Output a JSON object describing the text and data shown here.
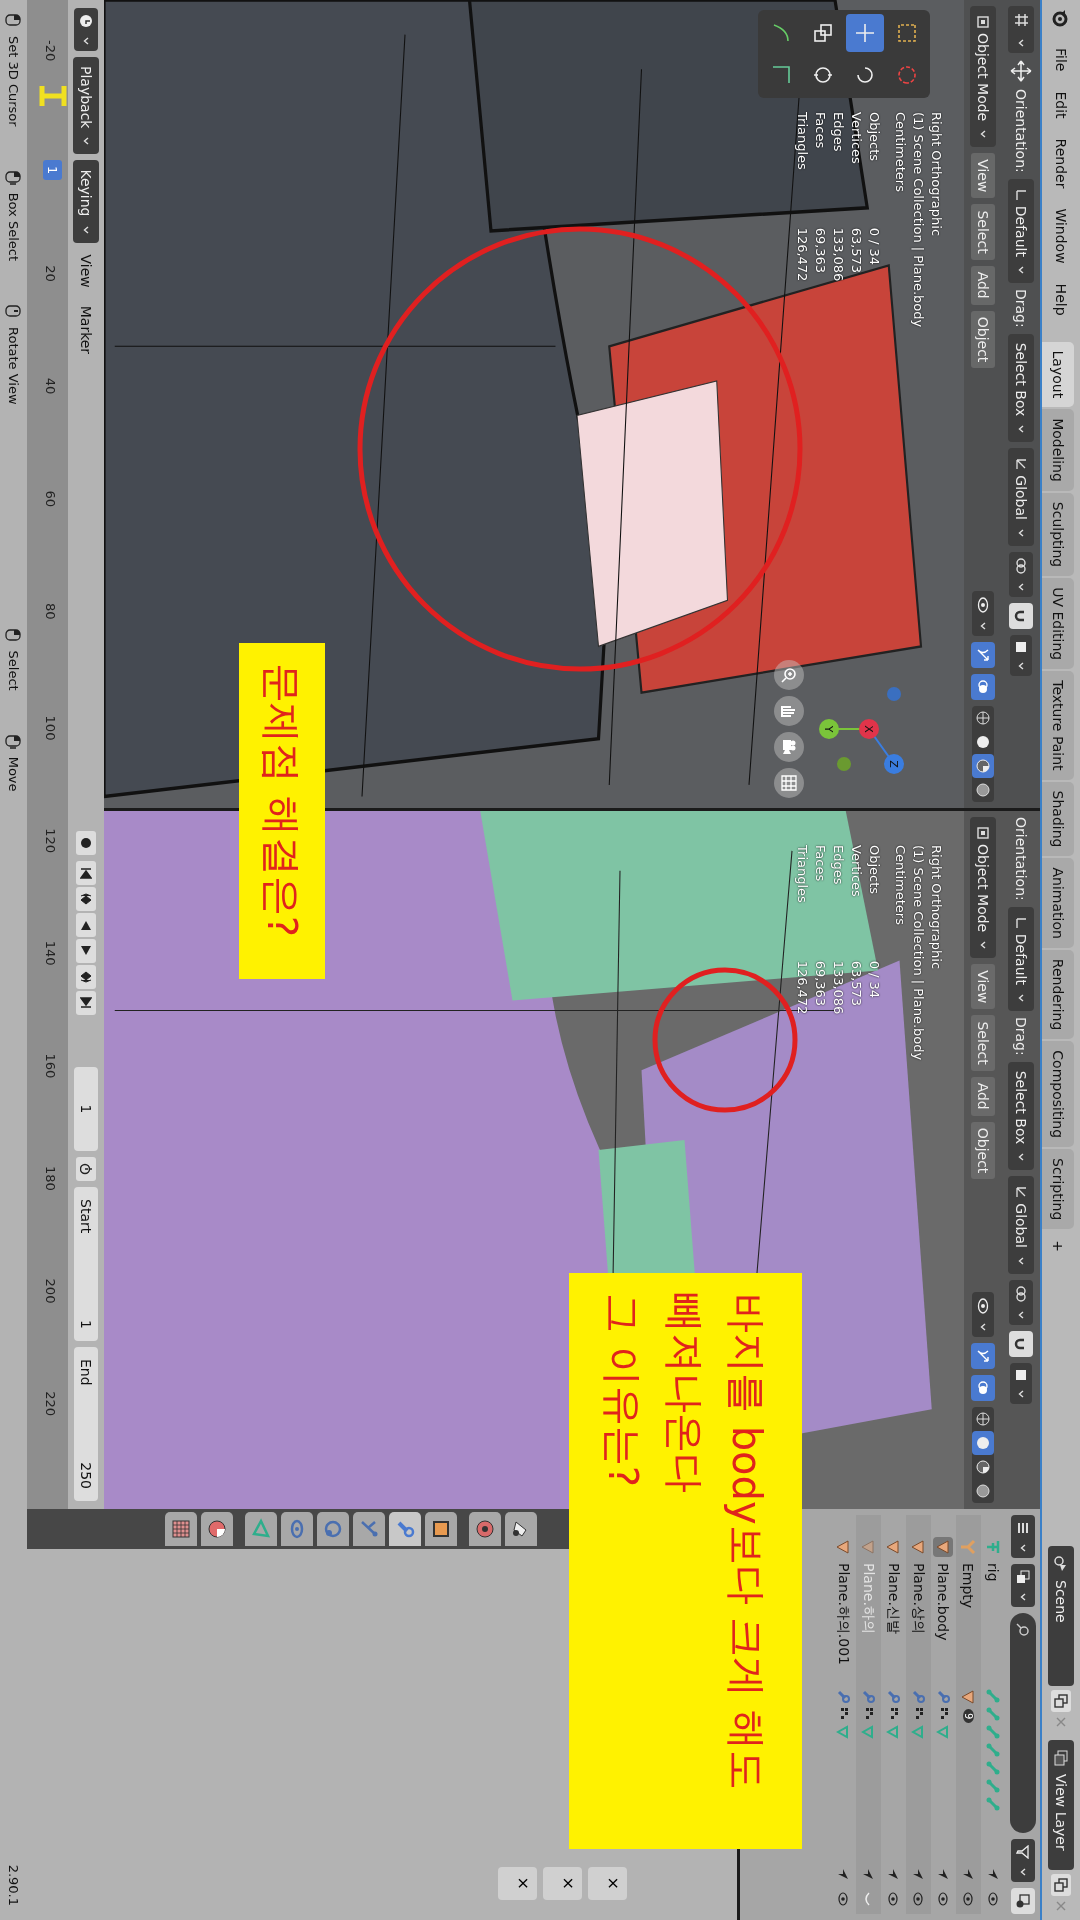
{
  "menu_bar": {
    "menus": [
      "File",
      "Edit",
      "Render",
      "Window",
      "Help"
    ],
    "workspace_tabs": [
      {
        "label": "Layout",
        "selected": true
      },
      {
        "label": "Modeling",
        "selected": false
      },
      {
        "label": "Sculpting",
        "selected": false
      },
      {
        "label": "UV Editing",
        "selected": false
      },
      {
        "label": "Texture Paint",
        "selected": false
      },
      {
        "label": "Shading",
        "selected": false
      },
      {
        "label": "Animation",
        "selected": false
      },
      {
        "label": "Rendering",
        "selected": false
      },
      {
        "label": "Compositing",
        "selected": false
      },
      {
        "label": "Scripting",
        "selected": false
      }
    ],
    "add_tab": "+",
    "scene": "Scene",
    "view_layer": "View Layer"
  },
  "viewports": [
    {
      "active_tool_button": true,
      "orientation_label": "Orientation:",
      "orientation": "Default",
      "drag_label": "Drag:",
      "drag": "Select Box",
      "transform_orientation": "Global",
      "mode": "Object Mode",
      "menus": [
        "View",
        "Select",
        "Add",
        "Object"
      ],
      "shading": [
        {
          "kind": "wireframe",
          "selected": false
        },
        {
          "kind": "solid",
          "selected": false
        },
        {
          "kind": "material",
          "selected": true
        },
        {
          "kind": "rendered",
          "selected": false
        }
      ],
      "tools": [
        {
          "kind": "select",
          "selected": false
        },
        {
          "kind": "cursor",
          "selected": false
        },
        {
          "kind": "move",
          "selected": true
        },
        {
          "kind": "rotate",
          "selected": false
        },
        {
          "kind": "scale",
          "selected": false
        },
        {
          "kind": "transform",
          "selected": false
        },
        {
          "kind": "annotate",
          "selected": false
        },
        {
          "kind": "measure",
          "selected": false
        }
      ],
      "overlay": [
        "Right Orthographic",
        "(1) Scene Collection | Plane.body",
        "Centimeters"
      ],
      "stats": [
        {
          "label": "Objects",
          "value": "0 / 34"
        },
        {
          "label": "Vertices",
          "value": "63,573"
        },
        {
          "label": "Edges",
          "value": "133,086"
        },
        {
          "label": "Faces",
          "value": "69,363"
        },
        {
          "label": "Triangles",
          "value": "126,472"
        }
      ],
      "axes": [
        "X",
        "Y",
        "Z"
      ]
    },
    {
      "active_tool_button": false,
      "orientation_label": "Orientation:",
      "orientation": "Default",
      "drag_label": "Drag:",
      "drag": "Select Box",
      "transform_orientation": "Global",
      "mode": "Object Mode",
      "menus": [
        "View",
        "Select",
        "Add",
        "Object"
      ],
      "shading": [
        {
          "kind": "wireframe",
          "selected": false
        },
        {
          "kind": "solid",
          "selected": true
        },
        {
          "kind": "material",
          "selected": false
        },
        {
          "kind": "rendered",
          "selected": false
        }
      ],
      "overlay": [
        "Right Orthographic",
        "(1) Scene Collection | Plane.body",
        "Centimeters"
      ],
      "stats": [
        {
          "label": "Objects",
          "value": "0 / 34"
        },
        {
          "label": "Vertices",
          "value": "63,573"
        },
        {
          "label": "Edges",
          "value": "133,086"
        },
        {
          "label": "Faces",
          "value": "69,363"
        },
        {
          "label": "Triangles",
          "value": "126,472"
        }
      ]
    }
  ],
  "annotations": [
    {
      "lines": [
        "문제점 해결은?"
      ]
    },
    {
      "lines": [
        "바지를 body보다 크게 해도",
        "빼져나온다",
        "그 이유는?"
      ]
    }
  ],
  "outliner": {
    "items": [
      {
        "name": "rig",
        "kind": "armature",
        "hidden": false,
        "active": false
      },
      {
        "name": "Empty",
        "kind": "empty",
        "hidden": false,
        "active": false,
        "badge": "9"
      },
      {
        "name": "Plane.body",
        "kind": "mesh",
        "hidden": false,
        "active": true
      },
      {
        "name": "Plane.상의",
        "kind": "mesh",
        "hidden": false,
        "active": false
      },
      {
        "name": "Plane.신발",
        "kind": "mesh",
        "hidden": false,
        "active": false
      },
      {
        "name": "Plane.하의",
        "kind": "mesh",
        "hidden": true,
        "active": false
      },
      {
        "name": "Plane.하의.001",
        "kind": "mesh",
        "hidden": false,
        "active": false
      }
    ]
  },
  "properties": {
    "tabs": [
      {
        "kind": "tool",
        "selected": false
      },
      {
        "kind": "render",
        "selected": false
      },
      {
        "kind": "object",
        "selected": false
      },
      {
        "kind": "modifiers",
        "selected": true
      },
      {
        "kind": "particles",
        "selected": false
      },
      {
        "kind": "physics",
        "selected": false
      },
      {
        "kind": "constraints",
        "selected": false
      },
      {
        "kind": "data",
        "selected": false
      },
      {
        "kind": "material",
        "selected": false
      },
      {
        "kind": "texture",
        "selected": false
      }
    ],
    "close_buttons": [
      "×",
      "×",
      "×"
    ]
  },
  "timeline": {
    "menus": [
      {
        "label": "Playback",
        "dropdown": true
      },
      {
        "label": "Keying",
        "dropdown": true
      },
      {
        "label": "View",
        "dropdown": false
      },
      {
        "label": "Marker",
        "dropdown": false
      }
    ],
    "current_frame": "1",
    "start_label": "Start",
    "start": "1",
    "end_label": "End",
    "end": "250",
    "ruler": [
      "-20",
      "20",
      "40",
      "60",
      "80",
      "100",
      "120",
      "140",
      "160",
      "180",
      "200",
      "220"
    ],
    "playhead": "1"
  },
  "status_bar": {
    "hints": [
      {
        "label": "Set 3D Cursor",
        "kind": "left"
      },
      {
        "label": "Box Select",
        "kind": "drag"
      },
      {
        "label": "Rotate View",
        "kind": "middle"
      },
      {
        "label": "Select",
        "kind": "left"
      },
      {
        "label": "Move",
        "kind": "drag"
      }
    ],
    "version": "2.90.1"
  }
}
